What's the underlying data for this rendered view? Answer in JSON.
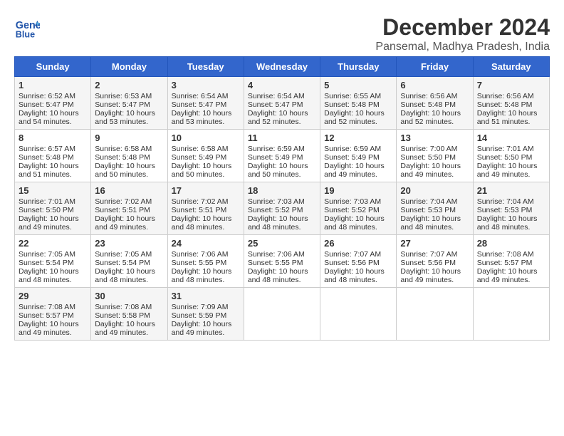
{
  "logo": {
    "line1": "General",
    "line2": "Blue"
  },
  "title": "December 2024",
  "subtitle": "Pansemal, Madhya Pradesh, India",
  "headers": [
    "Sunday",
    "Monday",
    "Tuesday",
    "Wednesday",
    "Thursday",
    "Friday",
    "Saturday"
  ],
  "weeks": [
    [
      {
        "day": "1",
        "sunrise": "6:52 AM",
        "sunset": "5:47 PM",
        "daylight": "10 hours and 54 minutes."
      },
      {
        "day": "2",
        "sunrise": "6:53 AM",
        "sunset": "5:47 PM",
        "daylight": "10 hours and 53 minutes."
      },
      {
        "day": "3",
        "sunrise": "6:54 AM",
        "sunset": "5:47 PM",
        "daylight": "10 hours and 53 minutes."
      },
      {
        "day": "4",
        "sunrise": "6:54 AM",
        "sunset": "5:47 PM",
        "daylight": "10 hours and 52 minutes."
      },
      {
        "day": "5",
        "sunrise": "6:55 AM",
        "sunset": "5:48 PM",
        "daylight": "10 hours and 52 minutes."
      },
      {
        "day": "6",
        "sunrise": "6:56 AM",
        "sunset": "5:48 PM",
        "daylight": "10 hours and 52 minutes."
      },
      {
        "day": "7",
        "sunrise": "6:56 AM",
        "sunset": "5:48 PM",
        "daylight": "10 hours and 51 minutes."
      }
    ],
    [
      {
        "day": "8",
        "sunrise": "6:57 AM",
        "sunset": "5:48 PM",
        "daylight": "10 hours and 51 minutes."
      },
      {
        "day": "9",
        "sunrise": "6:58 AM",
        "sunset": "5:48 PM",
        "daylight": "10 hours and 50 minutes."
      },
      {
        "day": "10",
        "sunrise": "6:58 AM",
        "sunset": "5:49 PM",
        "daylight": "10 hours and 50 minutes."
      },
      {
        "day": "11",
        "sunrise": "6:59 AM",
        "sunset": "5:49 PM",
        "daylight": "10 hours and 50 minutes."
      },
      {
        "day": "12",
        "sunrise": "6:59 AM",
        "sunset": "5:49 PM",
        "daylight": "10 hours and 49 minutes."
      },
      {
        "day": "13",
        "sunrise": "7:00 AM",
        "sunset": "5:50 PM",
        "daylight": "10 hours and 49 minutes."
      },
      {
        "day": "14",
        "sunrise": "7:01 AM",
        "sunset": "5:50 PM",
        "daylight": "10 hours and 49 minutes."
      }
    ],
    [
      {
        "day": "15",
        "sunrise": "7:01 AM",
        "sunset": "5:50 PM",
        "daylight": "10 hours and 49 minutes."
      },
      {
        "day": "16",
        "sunrise": "7:02 AM",
        "sunset": "5:51 PM",
        "daylight": "10 hours and 49 minutes."
      },
      {
        "day": "17",
        "sunrise": "7:02 AM",
        "sunset": "5:51 PM",
        "daylight": "10 hours and 48 minutes."
      },
      {
        "day": "18",
        "sunrise": "7:03 AM",
        "sunset": "5:52 PM",
        "daylight": "10 hours and 48 minutes."
      },
      {
        "day": "19",
        "sunrise": "7:03 AM",
        "sunset": "5:52 PM",
        "daylight": "10 hours and 48 minutes."
      },
      {
        "day": "20",
        "sunrise": "7:04 AM",
        "sunset": "5:53 PM",
        "daylight": "10 hours and 48 minutes."
      },
      {
        "day": "21",
        "sunrise": "7:04 AM",
        "sunset": "5:53 PM",
        "daylight": "10 hours and 48 minutes."
      }
    ],
    [
      {
        "day": "22",
        "sunrise": "7:05 AM",
        "sunset": "5:54 PM",
        "daylight": "10 hours and 48 minutes."
      },
      {
        "day": "23",
        "sunrise": "7:05 AM",
        "sunset": "5:54 PM",
        "daylight": "10 hours and 48 minutes."
      },
      {
        "day": "24",
        "sunrise": "7:06 AM",
        "sunset": "5:55 PM",
        "daylight": "10 hours and 48 minutes."
      },
      {
        "day": "25",
        "sunrise": "7:06 AM",
        "sunset": "5:55 PM",
        "daylight": "10 hours and 48 minutes."
      },
      {
        "day": "26",
        "sunrise": "7:07 AM",
        "sunset": "5:56 PM",
        "daylight": "10 hours and 48 minutes."
      },
      {
        "day": "27",
        "sunrise": "7:07 AM",
        "sunset": "5:56 PM",
        "daylight": "10 hours and 49 minutes."
      },
      {
        "day": "28",
        "sunrise": "7:08 AM",
        "sunset": "5:57 PM",
        "daylight": "10 hours and 49 minutes."
      }
    ],
    [
      {
        "day": "29",
        "sunrise": "7:08 AM",
        "sunset": "5:57 PM",
        "daylight": "10 hours and 49 minutes."
      },
      {
        "day": "30",
        "sunrise": "7:08 AM",
        "sunset": "5:58 PM",
        "daylight": "10 hours and 49 minutes."
      },
      {
        "day": "31",
        "sunrise": "7:09 AM",
        "sunset": "5:59 PM",
        "daylight": "10 hours and 49 minutes."
      },
      null,
      null,
      null,
      null
    ]
  ]
}
